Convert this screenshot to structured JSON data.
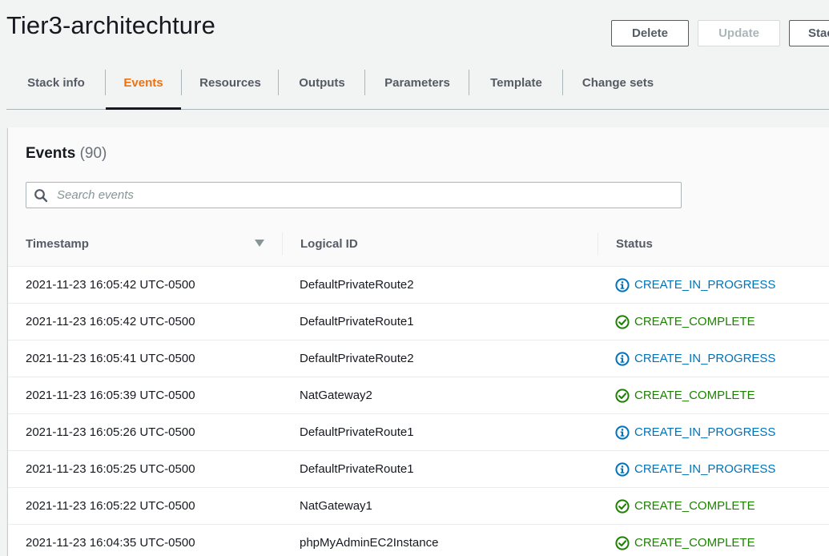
{
  "header": {
    "title": "Tier3-architechture",
    "buttons": {
      "delete": "Delete",
      "update": "Update",
      "stack_actions": "Stac"
    }
  },
  "tabs": [
    {
      "label": "Stack info",
      "active": false
    },
    {
      "label": "Events",
      "active": true
    },
    {
      "label": "Resources",
      "active": false
    },
    {
      "label": "Outputs",
      "active": false
    },
    {
      "label": "Parameters",
      "active": false
    },
    {
      "label": "Template",
      "active": false
    },
    {
      "label": "Change sets",
      "active": false
    }
  ],
  "events_panel": {
    "title": "Events",
    "count": "(90)",
    "search": {
      "placeholder": "Search events",
      "value": ""
    },
    "columns": {
      "timestamp": "Timestamp",
      "logical_id": "Logical ID",
      "status": "Status"
    },
    "rows": [
      {
        "timestamp": "2021-11-23 16:05:42 UTC-0500",
        "logical_id": "DefaultPrivateRoute2",
        "status": "CREATE_IN_PROGRESS",
        "status_type": "info-icon"
      },
      {
        "timestamp": "2021-11-23 16:05:42 UTC-0500",
        "logical_id": "DefaultPrivateRoute1",
        "status": "CREATE_COMPLETE",
        "status_type": "success-icon"
      },
      {
        "timestamp": "2021-11-23 16:05:41 UTC-0500",
        "logical_id": "DefaultPrivateRoute2",
        "status": "CREATE_IN_PROGRESS",
        "status_type": "info-icon"
      },
      {
        "timestamp": "2021-11-23 16:05:39 UTC-0500",
        "logical_id": "NatGateway2",
        "status": "CREATE_COMPLETE",
        "status_type": "success-icon"
      },
      {
        "timestamp": "2021-11-23 16:05:26 UTC-0500",
        "logical_id": "DefaultPrivateRoute1",
        "status": "CREATE_IN_PROGRESS",
        "status_type": "info-icon"
      },
      {
        "timestamp": "2021-11-23 16:05:25 UTC-0500",
        "logical_id": "DefaultPrivateRoute1",
        "status": "CREATE_IN_PROGRESS",
        "status_type": "info-icon"
      },
      {
        "timestamp": "2021-11-23 16:05:22 UTC-0500",
        "logical_id": "NatGateway1",
        "status": "CREATE_COMPLETE",
        "status_type": "success-icon"
      },
      {
        "timestamp": "2021-11-23 16:04:35 UTC-0500",
        "logical_id": "phpMyAdminEC2Instance",
        "status": "CREATE_COMPLETE",
        "status_type": "success-icon"
      }
    ]
  },
  "colors": {
    "accent_tab": "#ec7211",
    "in_progress": "#0073bb",
    "complete": "#1d8102"
  }
}
